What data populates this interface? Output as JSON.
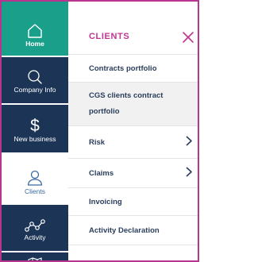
{
  "nav": {
    "items": [
      {
        "label": "Home",
        "icon": "home-icon"
      },
      {
        "label": "Company Info",
        "icon": "search-icon"
      },
      {
        "label": "New business",
        "icon": "dollar-icon"
      },
      {
        "label": "Clients",
        "icon": "user-icon"
      },
      {
        "label": "Activity",
        "icon": "activity-graph-icon"
      },
      {
        "label": "",
        "icon": "map-icon"
      }
    ]
  },
  "panel": {
    "title": "CLIENTS",
    "items": [
      {
        "label": "Contracts portfolio"
      },
      {
        "label_line1": "CGS clients contract",
        "label_line2": "portfolio"
      },
      {
        "label": "Risk"
      },
      {
        "label": "Claims"
      },
      {
        "label": "Invoicing"
      },
      {
        "label": "Activity Declaration"
      }
    ]
  },
  "colors": {
    "nav_bg": "#1c3556",
    "home_bg": "#1aa08a",
    "accent": "#c0358f",
    "active_text": "#3a6aa6"
  }
}
